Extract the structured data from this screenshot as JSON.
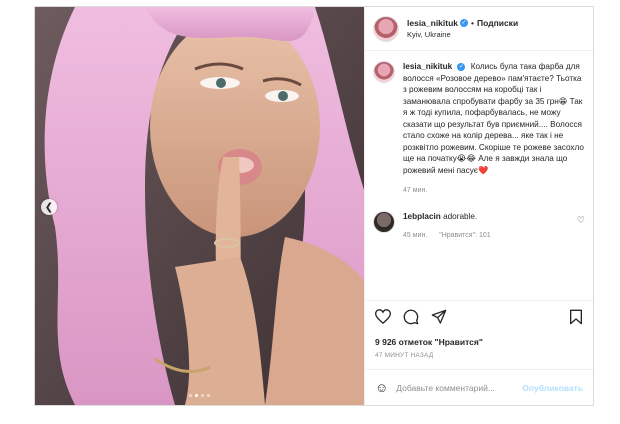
{
  "post": {
    "username": "lesia_nikituk",
    "verified": true,
    "follow_separator": "•",
    "follow_label": "Подписки",
    "location": "Kyiv, Ukraine"
  },
  "caption": {
    "username": "lesia_nikituk",
    "text": "Колись була така фарба для волосся «Розовое дерево» пам'ятаєте? Тьотка з рожевим волоссям на коробці так і заманювала спробувати фарбу за 35 грн😁 Так я ж тоді купила, пофарбувалась, не можу сказати що результат був приємний.... Волосся стало схоже на колір дерева... яке так і не розквітло рожевим. Скоріше те рожеве засохло ще на початку😭😂 Але я завжди знала що рожевий мені пасує❤️",
    "time": "47 мин."
  },
  "comment": {
    "username": "1ebplacin",
    "text": "adorable.",
    "time": "45 мин.",
    "likes_label": "\"Нравится\": 101"
  },
  "likes_label": "9 926 отметок \"Нравится\"",
  "post_time": "47 МИНУТ НАЗАД",
  "add_comment": {
    "placeholder": "Добавьте комментарий...",
    "publish_label": "Опубликовать"
  },
  "icons": {
    "prev": "chevron-left-icon",
    "like": "heart-icon",
    "comment": "comment-icon",
    "share": "paper-plane-icon",
    "save": "bookmark-icon",
    "emoji": "smiley-icon"
  },
  "carousel": {
    "total": 4,
    "active": 2
  },
  "colors": {
    "hair": "#e7a9cf",
    "verified": "#3897f0",
    "publish": "#b2dffc",
    "muted": "#8e8e8e"
  }
}
